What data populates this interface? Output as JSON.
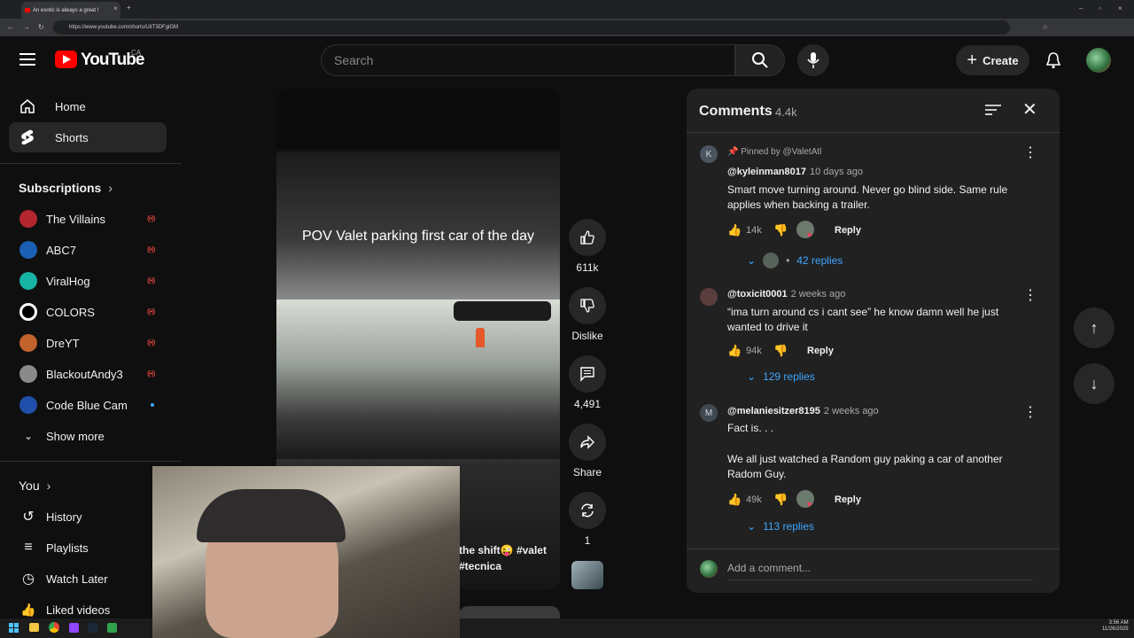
{
  "browser": {
    "tab_title": "An exotic is always a great !",
    "url": "https://www.youtube.com/shorts/UiIT3DFgiGM"
  },
  "header": {
    "logo_text": "YouTube",
    "country": "CA",
    "search_placeholder": "Search",
    "create_label": "Create"
  },
  "sidebar": {
    "home": "Home",
    "shorts": "Shorts",
    "subscriptions_title": "Subscriptions",
    "subscriptions": [
      {
        "name": "The Villains",
        "color": "#b4262e"
      },
      {
        "name": "ABC7",
        "color": "#1a5fb4"
      },
      {
        "name": "ViralHog",
        "color": "#17b3a3"
      },
      {
        "name": "COLORS",
        "color": "#ffffff"
      },
      {
        "name": "DreYT",
        "color": "#c2622d"
      },
      {
        "name": "BlackoutAndy3",
        "color": "#8a8a8a"
      },
      {
        "name": "Code Blue Cam",
        "color": "#1f4fa8"
      }
    ],
    "show_more": "Show more",
    "you_title": "You",
    "you_items": [
      "History",
      "Playlists",
      "Watch Later",
      "Liked videos"
    ]
  },
  "video": {
    "caption": "POV Valet parking first car of the day",
    "bottom_caption_1": "the shift😜 #valet",
    "bottom_caption_2": "#tecnica"
  },
  "actions": {
    "likes": "611k",
    "dislike_label": "Dislike",
    "comments_count": "4,491",
    "share_label": "Share",
    "remix_count": "1"
  },
  "comments_panel": {
    "title": "Comments",
    "count": "4.4k",
    "add_comment_placeholder": "Add a comment...",
    "comments": [
      {
        "pinned": "Pinned by @ValetAtl",
        "author": "@kyleinman8017",
        "time": "10 days ago",
        "text": "Smart move turning around. Never go blind side. Same rule applies when backing a trailer.",
        "likes": "14k",
        "reply": "Reply",
        "replies": "42 replies",
        "avatar_letter": "K"
      },
      {
        "author": "@toxicit0001",
        "time": "2 weeks ago",
        "text": "“ima turn around cs i cant see” he know damn well he just wanted to drive it",
        "likes": "94k",
        "reply": "Reply",
        "replies": "129 replies"
      },
      {
        "author": "@melaniesitzer8195",
        "time": "2 weeks ago",
        "text_1": "Fact is. . .",
        "text_2": "We all just watched a Random guy paking a car of another Radom Guy.",
        "likes": "49k",
        "reply": "Reply",
        "replies": "113 replies",
        "avatar_letter": "M"
      }
    ]
  },
  "taskbar": {
    "time": "3:56 AM",
    "date": "11/26/2025"
  }
}
